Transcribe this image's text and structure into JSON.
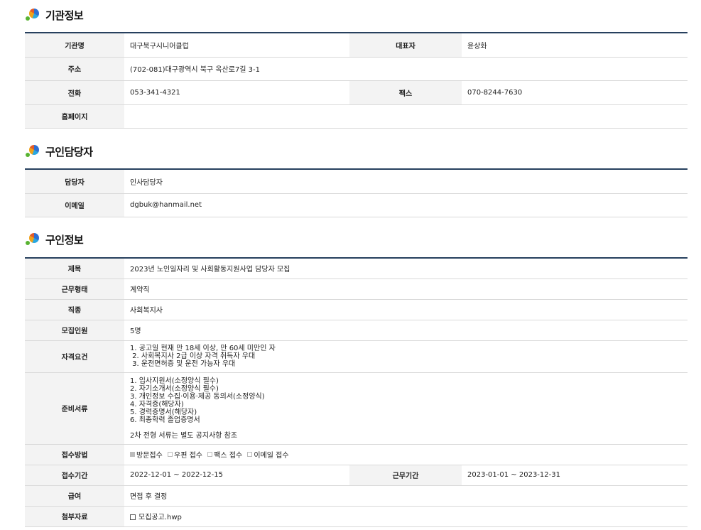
{
  "sections": {
    "org": {
      "title": "기관정보"
    },
    "contact": {
      "title": "구인담당자"
    },
    "job": {
      "title": "구인정보"
    }
  },
  "org": {
    "name_label": "기관명",
    "name": "대구북구시니어클럽",
    "rep_label": "대표자",
    "rep": "윤상화",
    "addr_label": "주소",
    "addr": "(702-081)대구광역시 북구 옥산로7길 3-1",
    "phone_label": "전화",
    "phone": "053-341-4321",
    "fax_label": "팩스",
    "fax": "070-8244-7630",
    "home_label": "홈페이지",
    "home": ""
  },
  "contact": {
    "person_label": "담당자",
    "person": "인사담당자",
    "email_label": "이메일",
    "email": "dgbuk@hanmail.net"
  },
  "job": {
    "title_label": "제목",
    "title": "2023년 노인일자리 및 사회활동지원사업 담당자 모집",
    "type_label": "근무형태",
    "type": "계약직",
    "category_label": "직종",
    "category": "사회복지사",
    "count_label": "모집인원",
    "count": "5명",
    "qual_label": "자격요건",
    "qual_lines": [
      "1. 공고일 현재 만 18세 이상, 만 60세 미만인 자",
      " 2. 사회복지사 2급 이상 자격 취득자 우대",
      " 3. 운전면허증 및 운전 가능자 우대"
    ],
    "docs_label": "준비서류",
    "docs_lines": [
      "1. 입사지원서(소정양식 필수)",
      "2. 자기소개서(소정양식 필수)",
      "3. 개인정보 수집·이용·제공 동의서(소정양식)",
      "4. 자격증(해당자)",
      "5. 경력증명서(해당자)",
      "6. 최종학력 졸업증명서",
      "",
      "2차 전형 서류는 별도 공지사항 참조"
    ],
    "method_label": "접수방법",
    "methods": [
      {
        "label": "방문접수",
        "checked": true
      },
      {
        "label": "우편 접수",
        "checked": false
      },
      {
        "label": "팩스 접수",
        "checked": false
      },
      {
        "label": "이메일 접수",
        "checked": false
      }
    ],
    "period_label": "접수기간",
    "period": "2022-12-01 ~ 2022-12-15",
    "work_period_label": "근무기간",
    "work_period": "2023-01-01 ~ 2023-12-31",
    "salary_label": "급여",
    "salary": "면접 후 결정",
    "attach_label": "첨부자료",
    "attach": "모집공고.hwp"
  }
}
